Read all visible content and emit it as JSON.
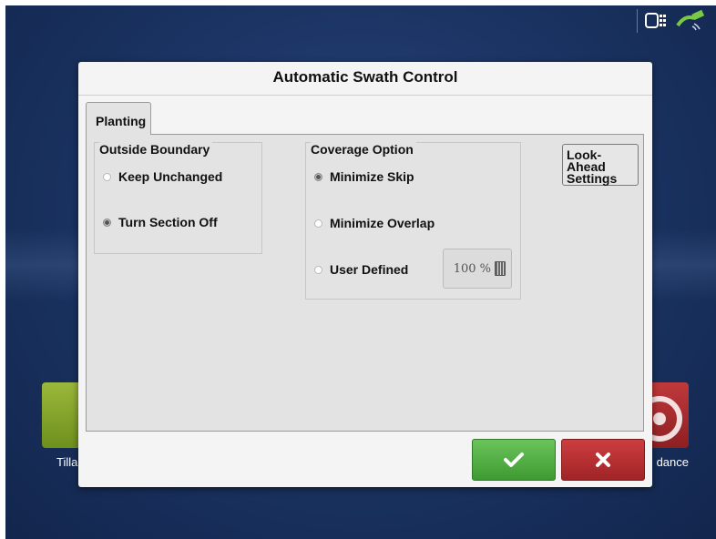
{
  "dialog": {
    "title": "Automatic Swath Control",
    "tabs": [
      {
        "label": "Planting"
      }
    ],
    "outside_boundary": {
      "title": "Outside Boundary",
      "options": [
        {
          "label": "Keep Unchanged",
          "selected": false
        },
        {
          "label": "Turn Section Off",
          "selected": true
        }
      ]
    },
    "coverage_option": {
      "title": "Coverage Option",
      "options": [
        {
          "label": "Minimize Skip",
          "selected": true
        },
        {
          "label": "Minimize Overlap",
          "selected": false
        },
        {
          "label": "User Defined",
          "selected": false
        }
      ],
      "user_defined_value": "100 %"
    },
    "lookahead_button": {
      "line1": "Look-Ahead",
      "line2": "Settings"
    },
    "ok_icon": "checkmark-icon",
    "cancel_icon": "x-icon"
  },
  "background": {
    "tile_left_label": "Tilla",
    "tile_right_label": "dance"
  },
  "status_icons": [
    "display-icon",
    "gps-satellite-icon"
  ],
  "colors": {
    "ok": "#4aa83d",
    "cancel": "#b02c2e",
    "screen_bg": "#1c3565"
  }
}
